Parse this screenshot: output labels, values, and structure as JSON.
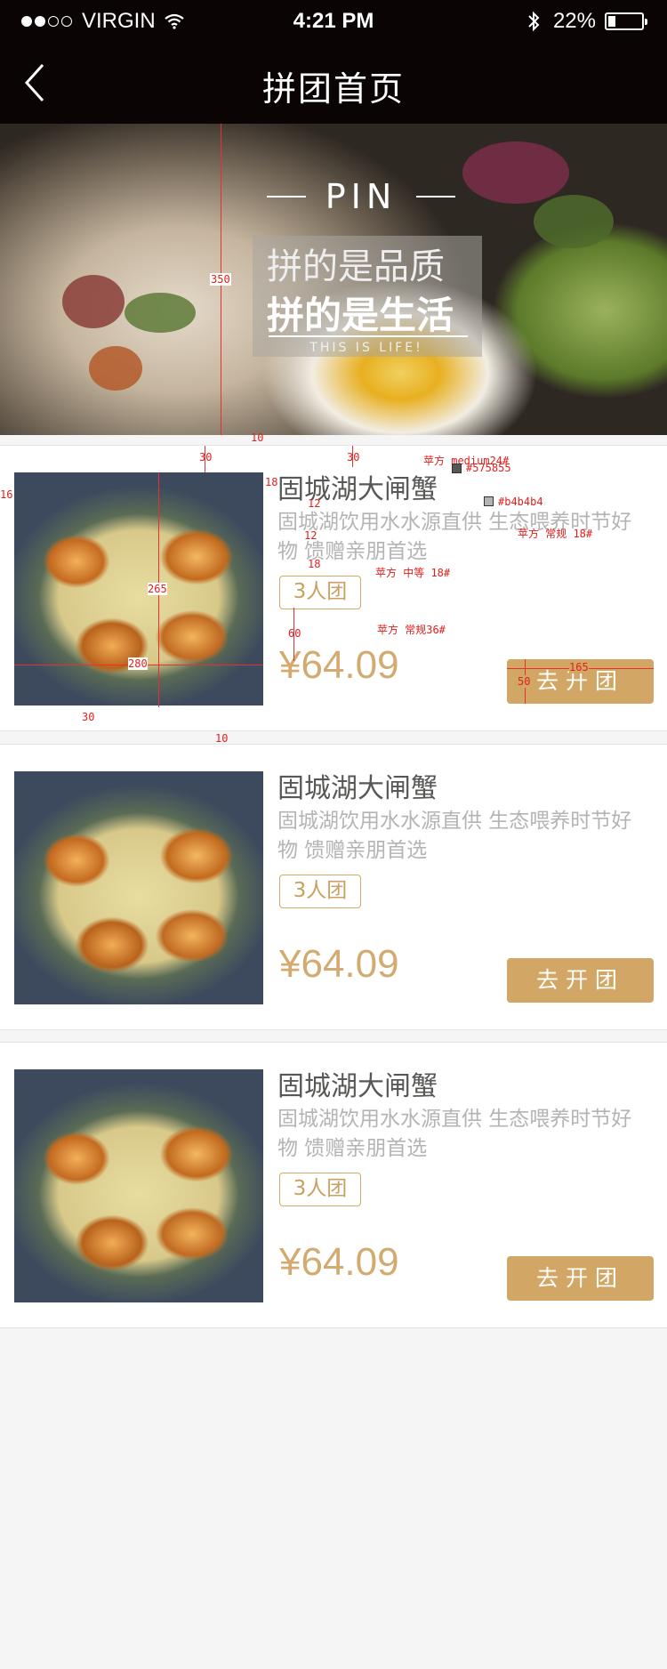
{
  "status_bar": {
    "carrier": "VIRGIN",
    "time": "4:21 PM",
    "battery": "22%",
    "battery_level": 0.22
  },
  "nav": {
    "title": "拼团首页"
  },
  "banner": {
    "pin": "PIN",
    "line1": "拼的是品质",
    "line2": "拼的是生活",
    "line3": "THIS IS LIFE!"
  },
  "products": [
    {
      "name": "固城湖大闸蟹",
      "desc": "固城湖饮用水水源直供 生态喂养时节好物 馈赠亲朋首选",
      "tag": "3人团",
      "price": "¥64.09",
      "button": "去开团"
    },
    {
      "name": "固城湖大闸蟹",
      "desc": "固城湖饮用水水源直供 生态喂养时节好物 馈赠亲朋首选",
      "tag": "3人团",
      "price": "¥64.09",
      "button": "去开团"
    },
    {
      "name": "固城湖大闸蟹",
      "desc": "固城湖饮用水水源直供 生态喂养时节好物 馈赠亲朋首选",
      "tag": "3人团",
      "price": "¥64.09",
      "button": "去开团"
    }
  ],
  "annotations": {
    "banner_height": "350",
    "gap1": "10",
    "gap2": "10",
    "margin_top1": "30",
    "margin_top2": "30",
    "left_margin": "16",
    "img_gap": "18",
    "title_gap": "12",
    "desc_gap": "12",
    "tag_gap": "18",
    "img_height": "265",
    "img_width": "280",
    "price_gap": "60",
    "bottom_margin": "30",
    "btn_height": "50",
    "btn_width": "165",
    "title_font": "苹方 medium24#",
    "title_color": "#575855",
    "desc_color": "#b4b4b4",
    "desc_font": "苹方 常规 18#",
    "tag_font": "苹方 中等 18#",
    "price_font": "苹方 常规36#"
  },
  "colors": {
    "nav_bg": "#0b0405",
    "accent": "#d2a664",
    "title": "#575855",
    "desc": "#b4b4b4"
  }
}
